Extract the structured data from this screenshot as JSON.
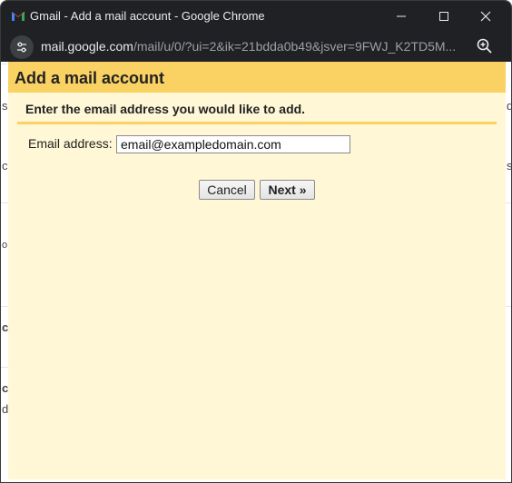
{
  "window": {
    "title": "Gmail - Add a mail account - Google Chrome",
    "url_host": "mail.google.com",
    "url_path": "/mail/u/0/?ui=2&ik=21bdda0b49&jsver=9FWJ_K2TD5M..."
  },
  "dialog": {
    "title": "Add a mail account",
    "instruction": "Enter the email address you would like to add.",
    "email_label": "Email address:",
    "email_value": "email@exampledomain.com",
    "cancel_label": "Cancel",
    "next_label": "Next »"
  },
  "background_fragments": {
    "left": [
      "s",
      "c",
      "o",
      "c",
      "c",
      "d"
    ],
    "right": [
      "d",
      "s"
    ]
  },
  "colors": {
    "header_yellow": "#fad163",
    "dialog_bg": "#fff7d6",
    "chrome_dark": "#202124"
  },
  "icons": [
    "gmail-icon",
    "minimize-icon",
    "maximize-icon",
    "close-icon",
    "site-info-icon",
    "zoom-icon"
  ]
}
